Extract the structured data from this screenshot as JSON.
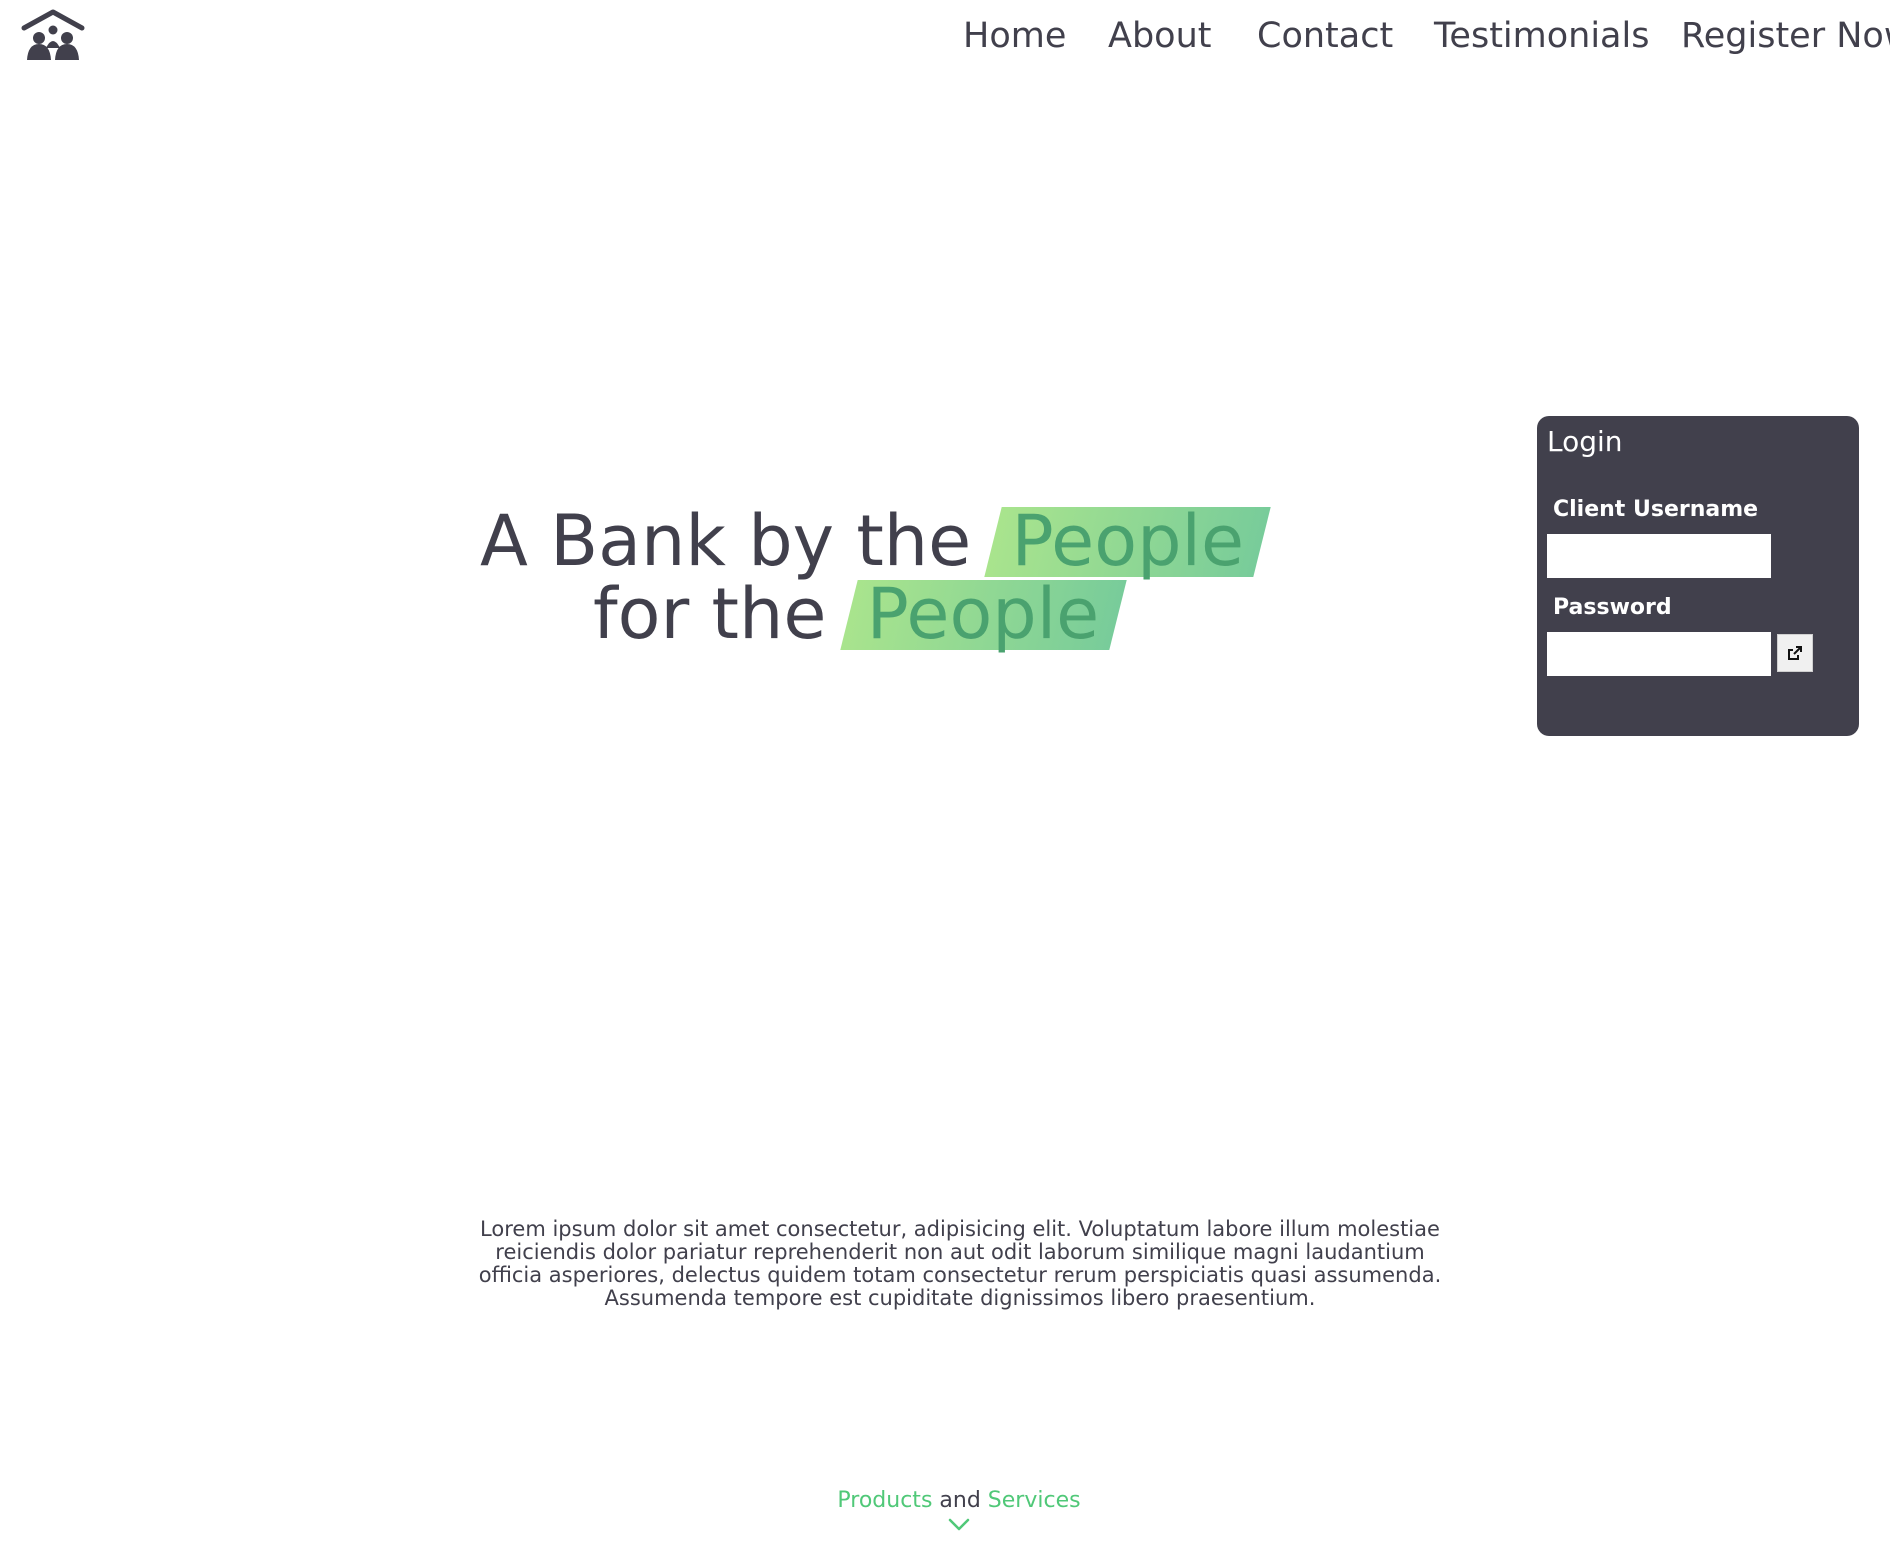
{
  "nav": {
    "items": [
      {
        "label": "Home"
      },
      {
        "label": "About"
      },
      {
        "label": "Contact"
      },
      {
        "label": "Testimonials"
      },
      {
        "label": "Register Now"
      }
    ]
  },
  "logo": {
    "icon": "house-with-people-icon"
  },
  "hero": {
    "line1_text": "A Bank by the",
    "line1_highlight": "People",
    "line2_text": "for the",
    "line2_highlight": "People"
  },
  "login": {
    "title": "Login",
    "username_label": "Client Username",
    "username_value": "",
    "password_label": "Password",
    "password_value": "",
    "submit_icon": "external-link-icon"
  },
  "intro": {
    "text": "Lorem ipsum dolor sit amet consectetur, adipisicing elit. Voluptatum labore illum molestiae reiciendis dolor pariatur reprehenderit non aut odit laborum similique magni laudantium officia asperiores, delectus quidem totam consectetur rerum perspiciatis quasi assumenda. Assumenda tempore est cupiditate dignissimos libero praesentium."
  },
  "products_services": {
    "word1": "Products",
    "word2": "and",
    "word3": "Services",
    "icon": "chevron-down-icon"
  },
  "colors": {
    "dark": "#41404c",
    "green": "#50c878",
    "highlight_start": "#a9e48d",
    "highlight_end": "#78cc9a"
  }
}
